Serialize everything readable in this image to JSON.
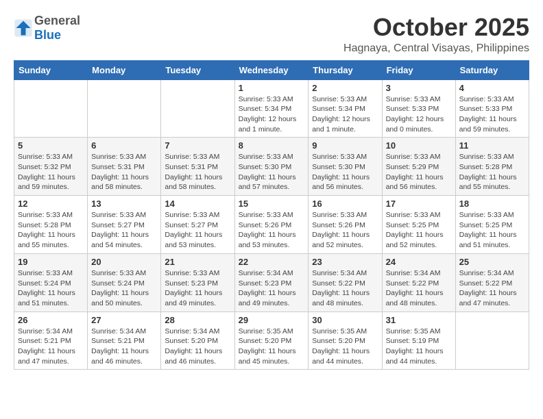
{
  "logo": {
    "general": "General",
    "blue": "Blue"
  },
  "header": {
    "month": "October 2025",
    "location": "Hagnaya, Central Visayas, Philippines"
  },
  "weekdays": [
    "Sunday",
    "Monday",
    "Tuesday",
    "Wednesday",
    "Thursday",
    "Friday",
    "Saturday"
  ],
  "weeks": [
    [
      {
        "day": "",
        "sunrise": "",
        "sunset": "",
        "daylight": ""
      },
      {
        "day": "",
        "sunrise": "",
        "sunset": "",
        "daylight": ""
      },
      {
        "day": "",
        "sunrise": "",
        "sunset": "",
        "daylight": ""
      },
      {
        "day": "1",
        "sunrise": "Sunrise: 5:33 AM",
        "sunset": "Sunset: 5:34 PM",
        "daylight": "Daylight: 12 hours and 1 minute."
      },
      {
        "day": "2",
        "sunrise": "Sunrise: 5:33 AM",
        "sunset": "Sunset: 5:34 PM",
        "daylight": "Daylight: 12 hours and 1 minute."
      },
      {
        "day": "3",
        "sunrise": "Sunrise: 5:33 AM",
        "sunset": "Sunset: 5:33 PM",
        "daylight": "Daylight: 12 hours and 0 minutes."
      },
      {
        "day": "4",
        "sunrise": "Sunrise: 5:33 AM",
        "sunset": "Sunset: 5:33 PM",
        "daylight": "Daylight: 11 hours and 59 minutes."
      }
    ],
    [
      {
        "day": "5",
        "sunrise": "Sunrise: 5:33 AM",
        "sunset": "Sunset: 5:32 PM",
        "daylight": "Daylight: 11 hours and 59 minutes."
      },
      {
        "day": "6",
        "sunrise": "Sunrise: 5:33 AM",
        "sunset": "Sunset: 5:31 PM",
        "daylight": "Daylight: 11 hours and 58 minutes."
      },
      {
        "day": "7",
        "sunrise": "Sunrise: 5:33 AM",
        "sunset": "Sunset: 5:31 PM",
        "daylight": "Daylight: 11 hours and 58 minutes."
      },
      {
        "day": "8",
        "sunrise": "Sunrise: 5:33 AM",
        "sunset": "Sunset: 5:30 PM",
        "daylight": "Daylight: 11 hours and 57 minutes."
      },
      {
        "day": "9",
        "sunrise": "Sunrise: 5:33 AM",
        "sunset": "Sunset: 5:30 PM",
        "daylight": "Daylight: 11 hours and 56 minutes."
      },
      {
        "day": "10",
        "sunrise": "Sunrise: 5:33 AM",
        "sunset": "Sunset: 5:29 PM",
        "daylight": "Daylight: 11 hours and 56 minutes."
      },
      {
        "day": "11",
        "sunrise": "Sunrise: 5:33 AM",
        "sunset": "Sunset: 5:28 PM",
        "daylight": "Daylight: 11 hours and 55 minutes."
      }
    ],
    [
      {
        "day": "12",
        "sunrise": "Sunrise: 5:33 AM",
        "sunset": "Sunset: 5:28 PM",
        "daylight": "Daylight: 11 hours and 55 minutes."
      },
      {
        "day": "13",
        "sunrise": "Sunrise: 5:33 AM",
        "sunset": "Sunset: 5:27 PM",
        "daylight": "Daylight: 11 hours and 54 minutes."
      },
      {
        "day": "14",
        "sunrise": "Sunrise: 5:33 AM",
        "sunset": "Sunset: 5:27 PM",
        "daylight": "Daylight: 11 hours and 53 minutes."
      },
      {
        "day": "15",
        "sunrise": "Sunrise: 5:33 AM",
        "sunset": "Sunset: 5:26 PM",
        "daylight": "Daylight: 11 hours and 53 minutes."
      },
      {
        "day": "16",
        "sunrise": "Sunrise: 5:33 AM",
        "sunset": "Sunset: 5:26 PM",
        "daylight": "Daylight: 11 hours and 52 minutes."
      },
      {
        "day": "17",
        "sunrise": "Sunrise: 5:33 AM",
        "sunset": "Sunset: 5:25 PM",
        "daylight": "Daylight: 11 hours and 52 minutes."
      },
      {
        "day": "18",
        "sunrise": "Sunrise: 5:33 AM",
        "sunset": "Sunset: 5:25 PM",
        "daylight": "Daylight: 11 hours and 51 minutes."
      }
    ],
    [
      {
        "day": "19",
        "sunrise": "Sunrise: 5:33 AM",
        "sunset": "Sunset: 5:24 PM",
        "daylight": "Daylight: 11 hours and 51 minutes."
      },
      {
        "day": "20",
        "sunrise": "Sunrise: 5:33 AM",
        "sunset": "Sunset: 5:24 PM",
        "daylight": "Daylight: 11 hours and 50 minutes."
      },
      {
        "day": "21",
        "sunrise": "Sunrise: 5:33 AM",
        "sunset": "Sunset: 5:23 PM",
        "daylight": "Daylight: 11 hours and 49 minutes."
      },
      {
        "day": "22",
        "sunrise": "Sunrise: 5:34 AM",
        "sunset": "Sunset: 5:23 PM",
        "daylight": "Daylight: 11 hours and 49 minutes."
      },
      {
        "day": "23",
        "sunrise": "Sunrise: 5:34 AM",
        "sunset": "Sunset: 5:22 PM",
        "daylight": "Daylight: 11 hours and 48 minutes."
      },
      {
        "day": "24",
        "sunrise": "Sunrise: 5:34 AM",
        "sunset": "Sunset: 5:22 PM",
        "daylight": "Daylight: 11 hours and 48 minutes."
      },
      {
        "day": "25",
        "sunrise": "Sunrise: 5:34 AM",
        "sunset": "Sunset: 5:22 PM",
        "daylight": "Daylight: 11 hours and 47 minutes."
      }
    ],
    [
      {
        "day": "26",
        "sunrise": "Sunrise: 5:34 AM",
        "sunset": "Sunset: 5:21 PM",
        "daylight": "Daylight: 11 hours and 47 minutes."
      },
      {
        "day": "27",
        "sunrise": "Sunrise: 5:34 AM",
        "sunset": "Sunset: 5:21 PM",
        "daylight": "Daylight: 11 hours and 46 minutes."
      },
      {
        "day": "28",
        "sunrise": "Sunrise: 5:34 AM",
        "sunset": "Sunset: 5:20 PM",
        "daylight": "Daylight: 11 hours and 46 minutes."
      },
      {
        "day": "29",
        "sunrise": "Sunrise: 5:35 AM",
        "sunset": "Sunset: 5:20 PM",
        "daylight": "Daylight: 11 hours and 45 minutes."
      },
      {
        "day": "30",
        "sunrise": "Sunrise: 5:35 AM",
        "sunset": "Sunset: 5:20 PM",
        "daylight": "Daylight: 11 hours and 44 minutes."
      },
      {
        "day": "31",
        "sunrise": "Sunrise: 5:35 AM",
        "sunset": "Sunset: 5:19 PM",
        "daylight": "Daylight: 11 hours and 44 minutes."
      },
      {
        "day": "",
        "sunrise": "",
        "sunset": "",
        "daylight": ""
      }
    ]
  ]
}
